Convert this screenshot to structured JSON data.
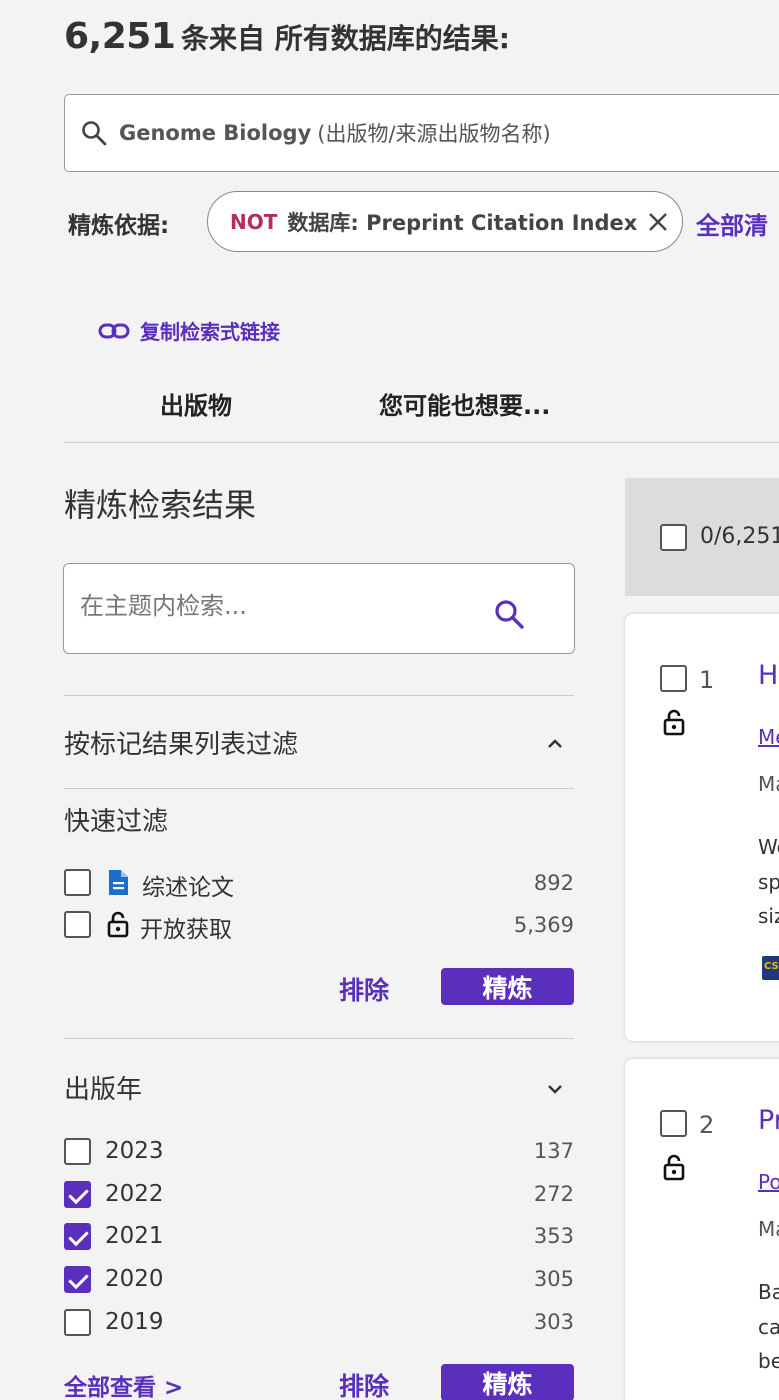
{
  "header": {
    "count": "6,251",
    "text": "条来自 所有数据库的结果:"
  },
  "search": {
    "query": "Genome Biology",
    "query_desc": "(出版物/来源出版物名称)"
  },
  "refine": {
    "label": "精炼依据:",
    "chip_not": "NOT",
    "chip_text": "数据库: Preprint Citation Index",
    "clear_all": "全部清"
  },
  "copy_link": "复制检索式链接",
  "tabs": [
    "出版物",
    "您可能也想要..."
  ],
  "sidebar": {
    "title": "精炼检索结果",
    "topic_search_placeholder": "在主题内检索...",
    "marked_filter_title": "按标记结果列表过滤",
    "quick_filter": {
      "title": "快速过滤",
      "items": [
        {
          "label": "综述论文",
          "count": "892",
          "icon": "document-icon"
        },
        {
          "label": "开放获取",
          "count": "5,369",
          "icon": "unlock-icon"
        }
      ],
      "exclude": "排除",
      "refine": "精炼"
    },
    "pub_year": {
      "title": "出版年",
      "items": [
        {
          "label": "2023",
          "count": "137",
          "checked": false
        },
        {
          "label": "2022",
          "count": "272",
          "checked": true
        },
        {
          "label": "2021",
          "count": "353",
          "checked": true
        },
        {
          "label": "2020",
          "count": "305",
          "checked": true
        },
        {
          "label": "2019",
          "count": "303",
          "checked": false
        }
      ],
      "view_all": "全部查看 >",
      "exclude": "排除",
      "refine": "精炼"
    }
  },
  "results": {
    "selected": "0/6,251",
    "cards": [
      {
        "num": "1",
        "title": "H",
        "author": "Me",
        "source": "Ma",
        "abstract": [
          "We",
          "sp",
          "siz"
        ],
        "logo": "CS"
      },
      {
        "num": "2",
        "title": "Pr",
        "author": "Po",
        "source": "Ma",
        "abstract": [
          "Ba",
          "ca",
          "be"
        ]
      }
    ]
  },
  "colors": {
    "accent": "#5b2fbd",
    "not": "#b72b5c"
  }
}
